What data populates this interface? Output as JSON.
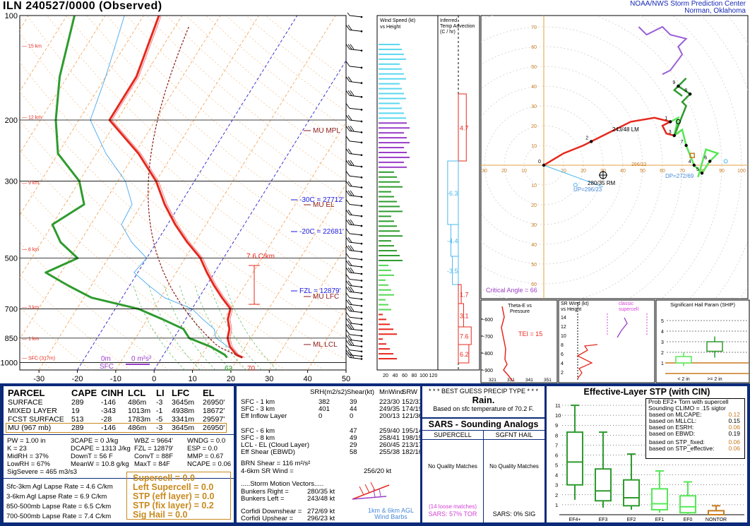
{
  "header": {
    "title": "ILN  240527/0000  (Observed)",
    "credit_line1": "NOAA/NWS Storm Prediction Center",
    "credit_line2": "Norman, Oklahoma"
  },
  "skewt": {
    "pressure_labels": [
      "100",
      "200",
      "300",
      "500",
      "700",
      "850",
      "1000"
    ],
    "temp_ticks": [
      "-30",
      "-20",
      "-10",
      "0",
      "10",
      "20",
      "30",
      "40",
      "50"
    ],
    "height_labels": [
      "15 km",
      "12 km",
      "9 km",
      "6 km",
      "3 km",
      "1 km",
      "SFC (317m)"
    ],
    "annotations": {
      "mu_mpl": "MU MPL",
      "mu_el": "MU EL",
      "mu_lfc": "MU LFC",
      "ml_lcl": "ML LCL",
      "m30c": "-30C = 27712'",
      "m20c": "-20C = 22681'",
      "fzl": "FZL = 12879'",
      "lapse": "7.6 C/km",
      "sfc_0m": "0m",
      "sfc_label": "SFC",
      "srh_0": "0 m²s²",
      "td_sfc": "63",
      "t_sfc": "70"
    }
  },
  "wind_panel": {
    "title": "Wind Speed (kt) vs Height",
    "x_ticks": [
      "20",
      "40",
      "60",
      "80",
      "100",
      "120"
    ]
  },
  "advection_panel": {
    "title": "Inferred Temp Advection (C / hr)",
    "values": [
      "4.7",
      "-6.3",
      "-4.4",
      "-3.5",
      "1.7",
      "3.1",
      "7.6",
      "6.2"
    ]
  },
  "hodograph": {
    "rings": [
      "10",
      "20",
      "30",
      "40",
      "50",
      "60",
      "70"
    ],
    "axis_labels": [
      "70",
      "60",
      "50",
      "40",
      "30",
      "20",
      "10",
      "10",
      "20",
      "30",
      "40",
      "50",
      "60",
      "70",
      "80",
      "90",
      "100",
      "110",
      "10",
      "20",
      "30",
      "40",
      "50",
      "60"
    ],
    "labels": {
      "lm": "243/48 LM",
      "rm": "280/35 RM",
      "up": "UP=296/23",
      "dp": "DP=272/69",
      "critical": "Critical Angle = 66",
      "storm": "266/22"
    }
  },
  "theta_panel": {
    "title1": "Theta-E vs",
    "title2": "Pressure",
    "tei": "TEI = 15",
    "y_ticks": [
      "600",
      "700",
      "800",
      "900"
    ],
    "x_ticks": [
      "321",
      "331",
      "341",
      "351"
    ]
  },
  "srwind_panel": {
    "title1": "SR Wind (kt)",
    "title2": "vs Height",
    "classic1": "classic",
    "classic2": "supercell",
    "y_ticks": [
      "14",
      "12",
      "10",
      "8",
      "6",
      "4",
      "2"
    ]
  },
  "ship_panel": {
    "title": "Significant Hail Param (SHIP)",
    "y_ticks": [
      "5",
      "4",
      "3",
      "2",
      "1"
    ],
    "x_labels": [
      "< 2 in",
      ">= 2 in"
    ]
  },
  "parcel_table": {
    "headers": [
      "PARCEL",
      "CAPE",
      "CINH",
      "LCL",
      "LI",
      "LFC",
      "EL"
    ],
    "rows": [
      [
        "SURFACE",
        "289",
        "-146",
        "486m",
        "-3",
        "3645m",
        "26950'"
      ],
      [
        "MIXED LAYER",
        "19",
        "-343",
        "1013m",
        "-1",
        "4938m",
        "18672'"
      ],
      [
        "FCST SURFACE",
        "513",
        "-28",
        "1783m",
        "-5",
        "3341m",
        "29597'"
      ],
      [
        "MU  (967 mb)",
        "289",
        "-146",
        "486m",
        "-3",
        "3645m",
        "26950'"
      ]
    ]
  },
  "indices": {
    "col1": [
      "PW = 1.00 in",
      "K = 23",
      "MidRH = 37%",
      "LowRH = 67%",
      "SigSevere = 465 m3/s3"
    ],
    "col2": [
      "3CAPE = 0 J/kg",
      "DCAPE = 1313 J/kg",
      "DownT = 56 F",
      "MeanW = 10.8 g/kg"
    ],
    "col3": [
      "WBZ = 9664'",
      "FZL = 12879'",
      "ConvT = 88F",
      "MaxT = 84F"
    ],
    "col4": [
      "WNDG = 0.0",
      "ESP = 0.0",
      "MMP = 0.67",
      "NCAPE = 0.06"
    ]
  },
  "lapse_rates": [
    "Sfc-3km Agl Lapse Rate =  4.6 C/km",
    "3-6km Agl Lapse Rate =  6.9 C/km",
    "850-500mb Lapse Rate =  6.5 C/km",
    "700-500mb Lapse Rate =  7.4 C/km"
  ],
  "composite_params": [
    "Supercell = 0.0",
    "Left Supercell = 0.0",
    "STP (eff layer) = 0.0",
    "STP (fix layer) = 0.2",
    "Sig Hail = 0.0"
  ],
  "kinematics": {
    "headers": [
      "SRH(m2/s2)",
      "Shear(kt)",
      "MnWind",
      "SRW"
    ],
    "rows": [
      [
        "SFC - 1 km",
        "382",
        "39",
        "223/30",
        "152/31"
      ],
      [
        "SFC - 3 km",
        "401",
        "44",
        "249/35",
        "174/19"
      ],
      [
        "Eff Inflow Layer",
        "0",
        "0",
        "200/13",
        "121/36"
      ],
      [
        "SFC - 6 km",
        "",
        "47",
        "259/40",
        "195/14"
      ],
      [
        "SFC - 8 km",
        "",
        "49",
        "258/41",
        "198/15"
      ],
      [
        "LCL - EL (Cloud Layer)",
        "",
        "29",
        "260/45",
        "213/17"
      ],
      [
        "Eff Shear (EBWD)",
        "",
        "58",
        "255/38",
        "182/16"
      ]
    ],
    "brn_shear": "BRN Shear = 116 m²/s²",
    "sr_wind": "4-6km SR Wind =",
    "sr_wind_val": "256/20 kt",
    "storm_vectors": ".....Storm Motion Vectors.....",
    "bunkers_right": "Bunkers Right =",
    "bunkers_right_val": "280/35 kt",
    "bunkers_left": "Bunkers Left =",
    "bunkers_left_val": "243/48 kt",
    "corfidi_down": "Corfidi Downshear =",
    "corfidi_down_val": "272/69 kt",
    "corfidi_up": "Corfidi Upshear =",
    "corfidi_up_val": "296/23 kt",
    "barbs_label1": "1km & 6km AGL",
    "barbs_label2": "Wind Barbs"
  },
  "precip": {
    "title": "* * * BEST GUESS PRECIP TYPE * * *",
    "value": "Rain.",
    "basis": "Based on sfc temperature of 70.2 F."
  },
  "sars": {
    "title": "SARS - Sounding Analogs",
    "col1": "SUPERCELL",
    "col2": "SGFNT HAIL",
    "nomatch1": "No Quality Matches",
    "nomatch2": "No Quality Matches",
    "loose": "(14 loose matches)",
    "sars_tor": "SARS:  57% TOR",
    "sars_sig": "SARS:  0% SIG"
  },
  "stp_panel": {
    "title": "Effective-Layer STP (with CIN)",
    "y_ticks": [
      "11",
      "10",
      "9",
      "8",
      "7",
      "6",
      "5",
      "4",
      "3",
      "2",
      "1"
    ],
    "categories": [
      "EF4+",
      "EF3",
      "EF2",
      "EF1",
      "EF0",
      "NONTOR"
    ],
    "legend_title1": "Prob EF2+ Torn with supercell",
    "legend_title2": "Sounding CLIMO = .15 sigtor",
    "legend_rows": [
      [
        "based on MLCAPE:",
        "0.12"
      ],
      [
        "based on MLLCL:",
        "0.15"
      ],
      [
        "based on ESRH:",
        "0.06"
      ],
      [
        "based on EBWD:",
        "0.19"
      ],
      [
        "based on STP_fixed:",
        "0.06"
      ],
      [
        "based on STP_effective:",
        "0.06"
      ]
    ]
  },
  "chart_data": {
    "type": "line",
    "title": "ILN 240527/0000 (Observed)",
    "series": [
      {
        "name": "Temperature",
        "units": "C",
        "pressure_mb": [
          967,
          950,
          900,
          850,
          800,
          750,
          700,
          650,
          600,
          550,
          500,
          450,
          400,
          350,
          300,
          250,
          200,
          150,
          100
        ],
        "values": [
          21,
          19,
          16,
          14,
          13,
          11,
          10,
          6,
          2,
          -2,
          -6,
          -12,
          -18,
          -24,
          -30,
          -39,
          -52,
          -52,
          -56
        ]
      },
      {
        "name": "Dewpoint",
        "units": "C",
        "pressure_mb": [
          967,
          950,
          900,
          850,
          800,
          750,
          700,
          650,
          600,
          550,
          500,
          450,
          400,
          350,
          300,
          250,
          200,
          150,
          100
        ],
        "values": [
          17,
          16,
          11,
          4,
          1,
          -6,
          -14,
          -28,
          -36,
          -44,
          -38,
          -45,
          -50,
          -45,
          -50,
          -60,
          -66,
          -72,
          -78
        ]
      }
    ],
    "stp_boxes": {
      "categories": [
        "EF4+",
        "EF3",
        "EF2",
        "EF1",
        "EF0",
        "NONTOR"
      ],
      "q10": [
        1.5,
        0.7,
        0.5,
        0.2,
        0.0,
        0.0
      ],
      "q25": [
        3.0,
        1.4,
        0.9,
        0.5,
        0.2,
        0.0
      ],
      "median": [
        5.3,
        2.4,
        1.7,
        1.1,
        0.8,
        0.0
      ],
      "q75": [
        8.3,
        4.6,
        3.5,
        2.6,
        1.9,
        0.4
      ],
      "q90": [
        11.0,
        8.3,
        6.1,
        4.4,
        3.3,
        0.9
      ]
    },
    "ship_boxes": {
      "categories": [
        "< 2 in",
        ">= 2 in"
      ],
      "q10": [
        0.7,
        1.5
      ],
      "q25": [
        1.0,
        2.1
      ],
      "median": [
        1.4,
        2.5
      ],
      "q75": [
        1.6,
        3.0
      ],
      "q90": [
        2.0,
        3.5
      ]
    },
    "ylim_pressure": [
      1050,
      100
    ],
    "xlim_temperature": [
      -30,
      50
    ]
  }
}
